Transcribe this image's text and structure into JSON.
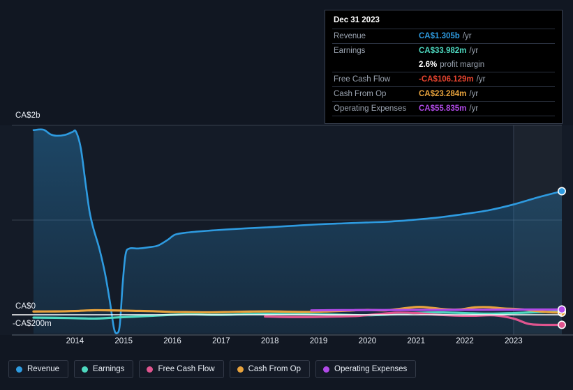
{
  "chart_data": {
    "type": "area",
    "title": "",
    "xlabel": "",
    "ylabel": "",
    "grid": true,
    "legend_position": "bottom",
    "currency": "CA$",
    "y_axis": {
      "labels": [
        "CA$2b",
        "CA$0",
        "-CA$200m"
      ],
      "values": [
        2000,
        0,
        -200
      ],
      "unit": "CA$ millions",
      "ylim": [
        -200,
        2000
      ],
      "gridlines": [
        2000,
        1000,
        0
      ]
    },
    "x_axis": {
      "tick_labels": [
        "2014",
        "2015",
        "2016",
        "2017",
        "2018",
        "2019",
        "2020",
        "2021",
        "2022",
        "2023"
      ]
    },
    "series": [
      {
        "name": "Revenue",
        "color": "#2e9be0",
        "filled": true,
        "endpoint_value": 1305,
        "points": [
          [
            2013.15,
            1950
          ],
          [
            2013.35,
            1955
          ],
          [
            2013.5,
            1905
          ],
          [
            2013.62,
            1890
          ],
          [
            2013.8,
            1900
          ],
          [
            2013.95,
            1930
          ],
          [
            2014.02,
            1935
          ],
          [
            2014.12,
            1760
          ],
          [
            2014.22,
            1380
          ],
          [
            2014.3,
            1090
          ],
          [
            2014.38,
            910
          ],
          [
            2014.5,
            700
          ],
          [
            2014.62,
            430
          ],
          [
            2014.72,
            130
          ],
          [
            2014.8,
            -140
          ],
          [
            2014.86,
            -195
          ],
          [
            2014.92,
            -110
          ],
          [
            2014.98,
            330
          ],
          [
            2015.04,
            640
          ],
          [
            2015.12,
            700
          ],
          [
            2015.3,
            700
          ],
          [
            2015.5,
            712
          ],
          [
            2015.7,
            730
          ],
          [
            2015.9,
            790
          ],
          [
            2016.05,
            845
          ],
          [
            2016.25,
            865
          ],
          [
            2016.5,
            878
          ],
          [
            2016.8,
            890
          ],
          [
            2017.1,
            900
          ],
          [
            2017.5,
            912
          ],
          [
            2018.0,
            925
          ],
          [
            2018.5,
            940
          ],
          [
            2019.0,
            955
          ],
          [
            2019.5,
            965
          ],
          [
            2020.0,
            975
          ],
          [
            2020.5,
            985
          ],
          [
            2021.0,
            1005
          ],
          [
            2021.5,
            1030
          ],
          [
            2022.0,
            1065
          ],
          [
            2022.5,
            1105
          ],
          [
            2023.0,
            1165
          ],
          [
            2023.5,
            1240
          ],
          [
            2023.99,
            1305
          ]
        ]
      },
      {
        "name": "Earnings",
        "color": "#4ed9c0",
        "filled": false,
        "endpoint_value": 33.982,
        "points": [
          [
            2013.15,
            -30
          ],
          [
            2013.6,
            -32
          ],
          [
            2014.0,
            -36
          ],
          [
            2014.4,
            -40
          ],
          [
            2014.8,
            -30
          ],
          [
            2015.2,
            -20
          ],
          [
            2015.6,
            -10
          ],
          [
            2016.0,
            0
          ],
          [
            2016.4,
            5
          ],
          [
            2016.8,
            0
          ],
          [
            2017.2,
            2
          ],
          [
            2017.6,
            8
          ],
          [
            2018.0,
            10
          ],
          [
            2018.5,
            8
          ],
          [
            2019.0,
            5
          ],
          [
            2019.5,
            0
          ],
          [
            2020.0,
            -5
          ],
          [
            2020.5,
            5
          ],
          [
            2021.0,
            20
          ],
          [
            2021.5,
            25
          ],
          [
            2022.0,
            18
          ],
          [
            2022.5,
            12
          ],
          [
            2023.0,
            18
          ],
          [
            2023.5,
            28
          ],
          [
            2023.99,
            33.982
          ]
        ]
      },
      {
        "name": "Free Cash Flow",
        "color": "#e0558f",
        "filled": false,
        "start_year": 2017.9,
        "endpoint_value": -106.129,
        "points": [
          [
            2017.9,
            -18
          ],
          [
            2018.2,
            -22
          ],
          [
            2018.6,
            -24
          ],
          [
            2019.0,
            -22
          ],
          [
            2019.4,
            -18
          ],
          [
            2019.8,
            -12
          ],
          [
            2020.2,
            6
          ],
          [
            2020.6,
            22
          ],
          [
            2021.0,
            18
          ],
          [
            2021.4,
            2
          ],
          [
            2021.8,
            -8
          ],
          [
            2022.2,
            -10
          ],
          [
            2022.6,
            -6
          ],
          [
            2023.0,
            -40
          ],
          [
            2023.3,
            -95
          ],
          [
            2023.6,
            -106
          ],
          [
            2023.99,
            -106.129
          ]
        ]
      },
      {
        "name": "Cash From Op",
        "color": "#e8a33d",
        "filled": false,
        "endpoint_value": 23.284,
        "points": [
          [
            2013.15,
            35
          ],
          [
            2013.6,
            36
          ],
          [
            2014.0,
            40
          ],
          [
            2014.4,
            48
          ],
          [
            2014.8,
            46
          ],
          [
            2015.2,
            42
          ],
          [
            2015.6,
            38
          ],
          [
            2016.0,
            30
          ],
          [
            2016.4,
            28
          ],
          [
            2016.8,
            26
          ],
          [
            2017.2,
            30
          ],
          [
            2017.6,
            34
          ],
          [
            2018.0,
            36
          ],
          [
            2018.4,
            32
          ],
          [
            2018.8,
            30
          ],
          [
            2019.2,
            36
          ],
          [
            2019.6,
            44
          ],
          [
            2020.0,
            52
          ],
          [
            2020.4,
            48
          ],
          [
            2021.0,
            82
          ],
          [
            2021.3,
            74
          ],
          [
            2021.6,
            58
          ],
          [
            2021.9,
            56
          ],
          [
            2022.2,
            78
          ],
          [
            2022.5,
            80
          ],
          [
            2022.8,
            66
          ],
          [
            2023.1,
            60
          ],
          [
            2023.4,
            44
          ],
          [
            2023.7,
            28
          ],
          [
            2023.99,
            23.284
          ]
        ]
      },
      {
        "name": "Operating Expenses",
        "color": "#b14ae8",
        "filled": false,
        "start_year": 2018.85,
        "endpoint_value": 55.835,
        "points": [
          [
            2018.85,
            46
          ],
          [
            2019.2,
            48
          ],
          [
            2019.6,
            49
          ],
          [
            2020.0,
            50
          ],
          [
            2020.4,
            50
          ],
          [
            2020.8,
            51
          ],
          [
            2021.2,
            52
          ],
          [
            2021.6,
            52
          ],
          [
            2022.0,
            53
          ],
          [
            2022.4,
            53
          ],
          [
            2022.8,
            54
          ],
          [
            2023.2,
            55
          ],
          [
            2023.6,
            55.5
          ],
          [
            2023.99,
            55.835
          ]
        ]
      }
    ],
    "highlight_band": {
      "start_year": 2023.0,
      "label": ""
    }
  },
  "tooltip": {
    "date": "Dec 31 2023",
    "rows": [
      {
        "label": "Revenue",
        "value": "CA$1.305b",
        "unit": "/yr",
        "color": "#2e9be0"
      },
      {
        "label": "Earnings",
        "value": "CA$33.982m",
        "unit": "/yr",
        "color": "#4ed9c0"
      },
      {
        "label": "",
        "value": "2.6%",
        "unit": "profit margin",
        "color": "#ffffff"
      },
      {
        "label": "Free Cash Flow",
        "value": "-CA$106.129m",
        "unit": "/yr",
        "color": "#e8442f"
      },
      {
        "label": "Cash From Op",
        "value": "CA$23.284m",
        "unit": "/yr",
        "color": "#e8a33d"
      },
      {
        "label": "Operating Expenses",
        "value": "CA$55.835m",
        "unit": "/yr",
        "color": "#b14ae8"
      }
    ]
  },
  "legend": {
    "items": [
      {
        "label": "Revenue",
        "color": "#2e9be0"
      },
      {
        "label": "Earnings",
        "color": "#4ed9c0"
      },
      {
        "label": "Free Cash Flow",
        "color": "#e0558f"
      },
      {
        "label": "Cash From Op",
        "color": "#e8a33d"
      },
      {
        "label": "Operating Expenses",
        "color": "#b14ae8"
      }
    ]
  }
}
